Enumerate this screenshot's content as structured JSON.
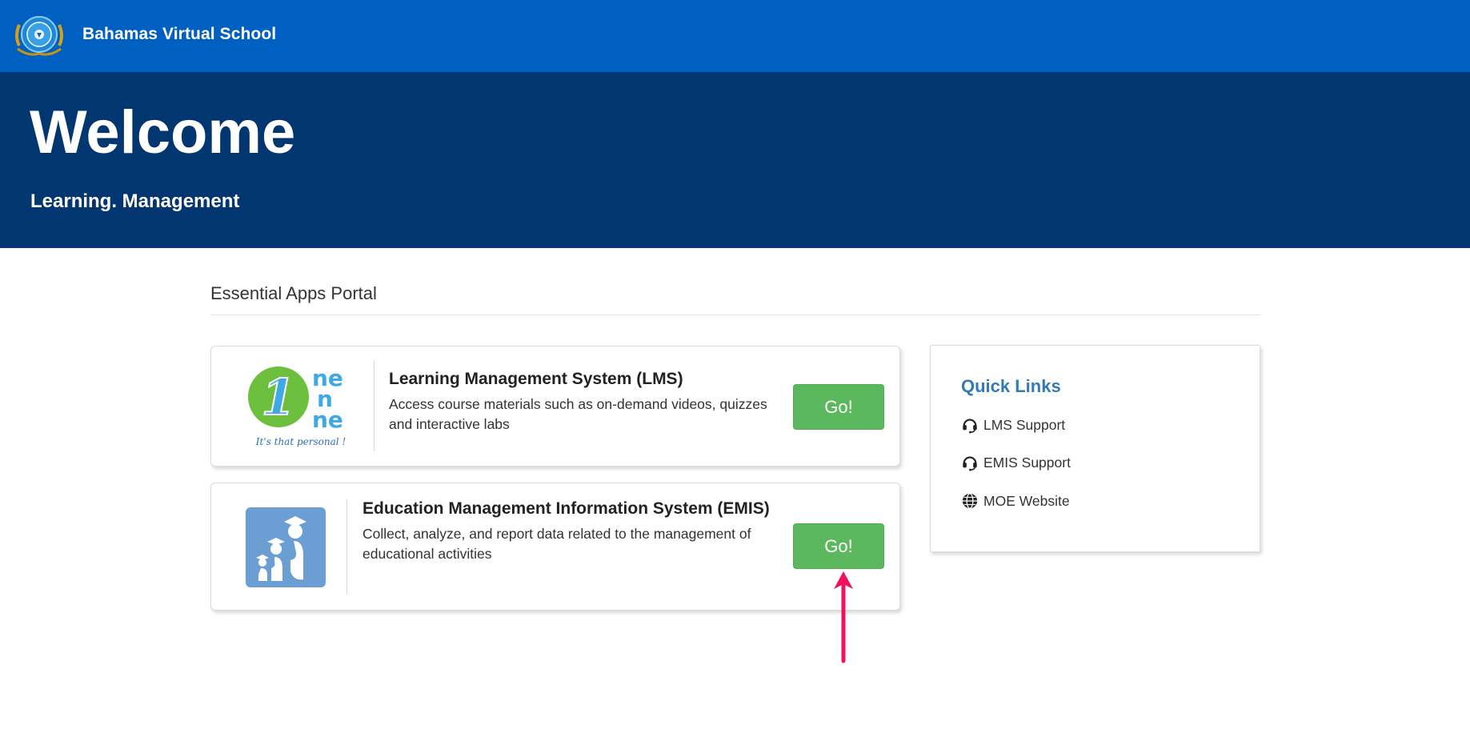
{
  "navbar": {
    "school_name": "Bahamas Virtual School"
  },
  "hero": {
    "title": "Welcome",
    "subtitle": "Learning. Management"
  },
  "portal": {
    "section_title": "Essential Apps Portal",
    "apps": [
      {
        "title": "Learning Management System (LMS)",
        "description": "Access course materials such as on-demand videos, quizzes and interactive labs",
        "button_label": "Go!",
        "logo": {
          "icon": "onenne-logo",
          "digit": "1",
          "letters": [
            "ne",
            "n",
            "ne"
          ],
          "tagline": "It's that personal !",
          "colors": {
            "circle": "#6dbf3e",
            "digit": "#3ea9e2",
            "letters": "#3ea9e2",
            "tagline": "#2a6fb5"
          }
        }
      },
      {
        "title": "Education Management Information System (EMIS)",
        "description": "Collect, analyze, and report data related to the management of educational activities",
        "button_label": "Go!",
        "logo": {
          "icon": "graduates-logo",
          "colors": {
            "background": "#6b9fd3"
          }
        }
      }
    ]
  },
  "quick_links": {
    "title": "Quick Links",
    "items": [
      {
        "label": "LMS Support",
        "icon": "headset-icon"
      },
      {
        "label": "EMIS Support",
        "icon": "headset-icon"
      },
      {
        "label": "MOE Website",
        "icon": "globe-icon"
      }
    ]
  },
  "colors": {
    "navbar": "#0060c2",
    "hero": "#023670",
    "button": "#5cb85c",
    "link_title": "#337ab7",
    "annotation_arrow": "#f0105c"
  }
}
